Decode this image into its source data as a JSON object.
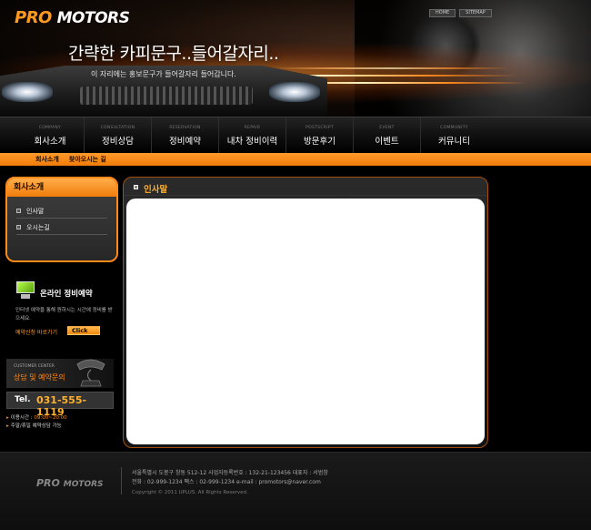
{
  "header": {
    "logo_pro": "PRO",
    "logo_motors": "MOTORS",
    "top_links": [
      "HOME",
      "SITEMAP"
    ],
    "headline": "간략한 카피문구..들어갈자리..",
    "subline": "이 자리에는 홍보문구가 들어갈자리 들어갑니다."
  },
  "nav": {
    "items": [
      {
        "en": "COMPANY",
        "ko": "회사소개"
      },
      {
        "en": "CONSULTATION",
        "ko": "정비상담"
      },
      {
        "en": "RESERVATION",
        "ko": "정비예약"
      },
      {
        "en": "REPAIR",
        "ko": "내차 정비이력"
      },
      {
        "en": "POSTSCRIPT",
        "ko": "방문후기"
      },
      {
        "en": "EVENT",
        "ko": "이벤트"
      },
      {
        "en": "COMMUNITY",
        "ko": "커뮤니티"
      }
    ]
  },
  "subnav": {
    "items": [
      "회사소개",
      "찾아오시는 길"
    ]
  },
  "sidebar": {
    "title": "회사소개",
    "links": [
      "인사말",
      "오시는길"
    ]
  },
  "reserve": {
    "title": "온라인 정비예약",
    "desc": "인터넷 예약을 통해 원하시는 시간에 정비를 받으세요.",
    "go_label": "예약신청 바로가기",
    "click_label": "Click"
  },
  "contact": {
    "en": "CUSTOMER CENTER",
    "ko": "상담 및 예약문의",
    "tel_label": "Tel.",
    "tel_number": "031-555-1119",
    "hours_label": "이용시간 :",
    "hours_value": "09:00~20:00",
    "holiday_note": "주말/휴일 예약상담 가능"
  },
  "main": {
    "title": "인사말"
  },
  "footer": {
    "logo_pro": "PRO",
    "logo_motors": "MOTORS",
    "line1": "서울특별시 도봉구 창동 512-12    사업자등록번호 : 132-21-123456    대표자 : 서범창",
    "line2": "전화 : 02-999-1234    팩스 : 02-999-1234    e-mail : promotors@naver.com",
    "copyright": "Copyright © 2011 UPLUS. All Rights Reserved."
  },
  "colors": {
    "accent": "#f07c0a",
    "accent_light": "#ffb030",
    "background": "#000000"
  }
}
